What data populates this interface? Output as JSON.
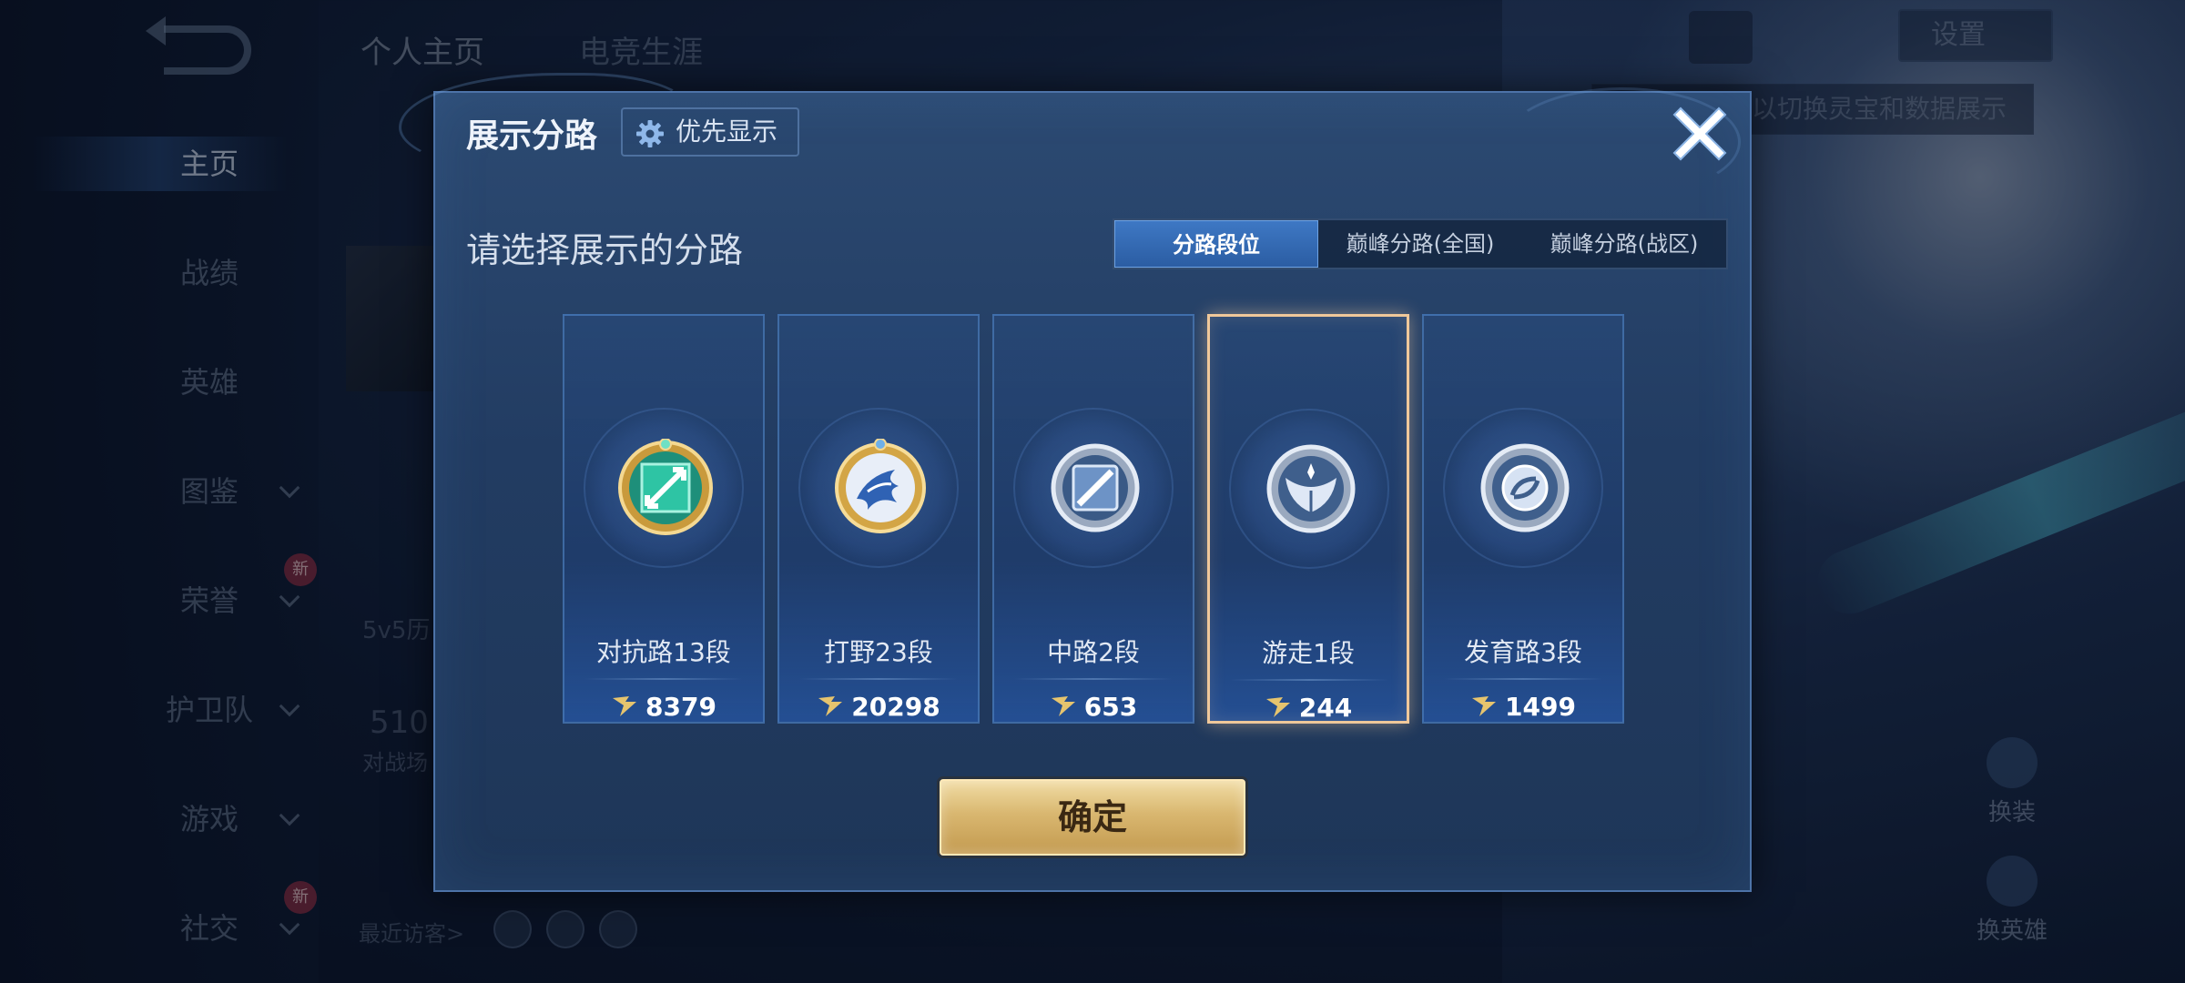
{
  "nav": {
    "items": [
      {
        "label": "主页",
        "active": true
      },
      {
        "label": "战绩"
      },
      {
        "label": "英雄"
      },
      {
        "label": "图鉴"
      },
      {
        "label": "荣誉"
      },
      {
        "label": "护卫队"
      },
      {
        "label": "游戏"
      },
      {
        "label": "社交"
      }
    ],
    "new_badge": "新"
  },
  "top_tabs": [
    "个人主页",
    "电竞生涯"
  ],
  "background": {
    "stat_label": "5v5历",
    "stat_number": "510",
    "stat_sub": "对战场",
    "recent_visitors": "最近访客>",
    "settings_label": "设置",
    "hint_text": "以切换灵宝和数据展示",
    "side_buttons": [
      "换装",
      "换英雄"
    ]
  },
  "dialog": {
    "title": "展示分路",
    "priority_button": "优先显示",
    "subtitle": "请选择展示的分路",
    "tabs": [
      {
        "label": "分路段位",
        "active": true
      },
      {
        "label": "巅峰分路(全国)"
      },
      {
        "label": "巅峰分路(战区)"
      }
    ],
    "lanes": [
      {
        "label": "对抗路13段",
        "score": "8379",
        "icon": "clash-lane-emblem-icon",
        "color": "#2bb89a"
      },
      {
        "label": "打野23段",
        "score": "20298",
        "icon": "jungle-dragon-emblem-icon",
        "color": "#3a6fc4"
      },
      {
        "label": "中路2段",
        "score": "653",
        "icon": "mid-lane-emblem-icon",
        "color": "#8aa4c8"
      },
      {
        "label": "游走1段",
        "score": "244",
        "icon": "roam-wings-emblem-icon",
        "color": "#8aa4c8",
        "selected": true
      },
      {
        "label": "发育路3段",
        "score": "1499",
        "icon": "farm-lane-emblem-icon",
        "color": "#8aa4c8"
      }
    ],
    "confirm_button": "确定"
  },
  "colors": {
    "accent_blue": "#2b5da3",
    "selected_border": "#f0c89a",
    "confirm_gold": "#d9b770"
  }
}
